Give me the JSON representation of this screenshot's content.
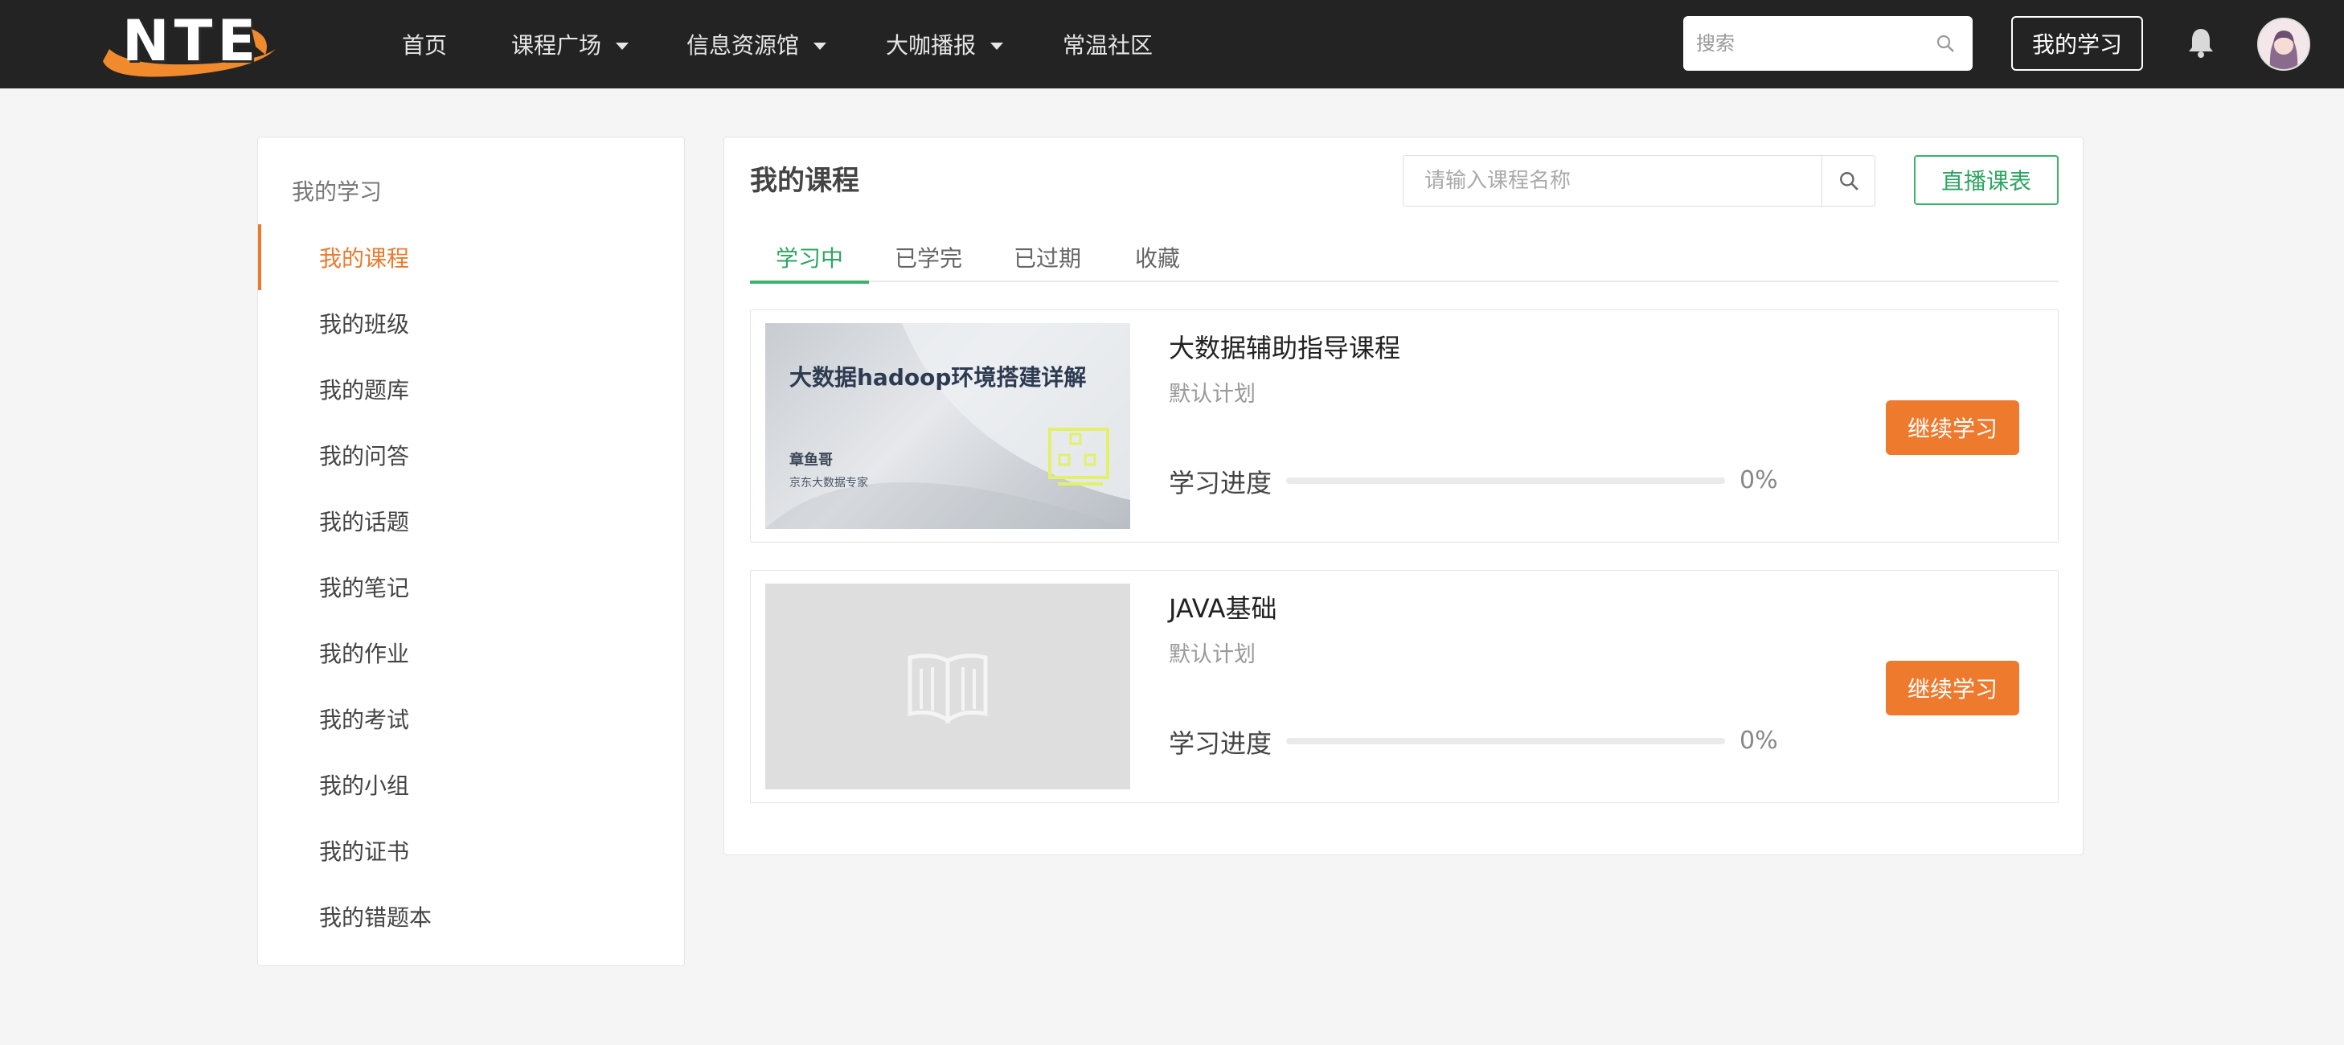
{
  "logo": {
    "text": "NTE"
  },
  "nav": {
    "items": [
      {
        "label": "首页",
        "has_dropdown": false
      },
      {
        "label": "课程广场",
        "has_dropdown": true
      },
      {
        "label": "信息资源馆",
        "has_dropdown": true
      },
      {
        "label": "大咖播报",
        "has_dropdown": true
      },
      {
        "label": "常温社区",
        "has_dropdown": false
      }
    ],
    "search_placeholder": "搜索",
    "my_study_label": "我的学习",
    "icons": [
      "search-icon",
      "bell-icon",
      "avatar"
    ]
  },
  "sidebar": {
    "title": "我的学习",
    "items": [
      {
        "label": "我的课程",
        "active": true
      },
      {
        "label": "我的班级"
      },
      {
        "label": "我的题库"
      },
      {
        "label": "我的问答"
      },
      {
        "label": "我的话题"
      },
      {
        "label": "我的笔记"
      },
      {
        "label": "我的作业"
      },
      {
        "label": "我的考试"
      },
      {
        "label": "我的小组"
      },
      {
        "label": "我的证书"
      },
      {
        "label": "我的错题本"
      }
    ]
  },
  "main": {
    "title": "我的课程",
    "search_placeholder": "请输入课程名称",
    "live_schedule_label": "直播课表",
    "tabs": [
      {
        "label": "学习中",
        "active": true
      },
      {
        "label": "已学完"
      },
      {
        "label": "已过期"
      },
      {
        "label": "收藏"
      }
    ],
    "courses": [
      {
        "name": "大数据辅助指导课程",
        "plan": "默认计划",
        "progress_label": "学习进度",
        "progress": 0,
        "progress_text": "0%",
        "button_label": "继续学习",
        "thumbnail": {
          "title": "大数据hadoop环境搭建详解",
          "author": "章鱼哥",
          "subtitle": "京东大数据专家"
        }
      },
      {
        "name": "JAVA基础",
        "plan": "默认计划",
        "progress_label": "学习进度",
        "progress": 0,
        "progress_text": "0%",
        "button_label": "继续学习",
        "thumbnail": {
          "placeholder_icon": "book-icon"
        }
      }
    ]
  },
  "colors": {
    "header_bg": "#232323",
    "accent_orange": "#ee7a2e",
    "accent_green": "#3bb36b",
    "page_bg": "#f5f5f5"
  }
}
